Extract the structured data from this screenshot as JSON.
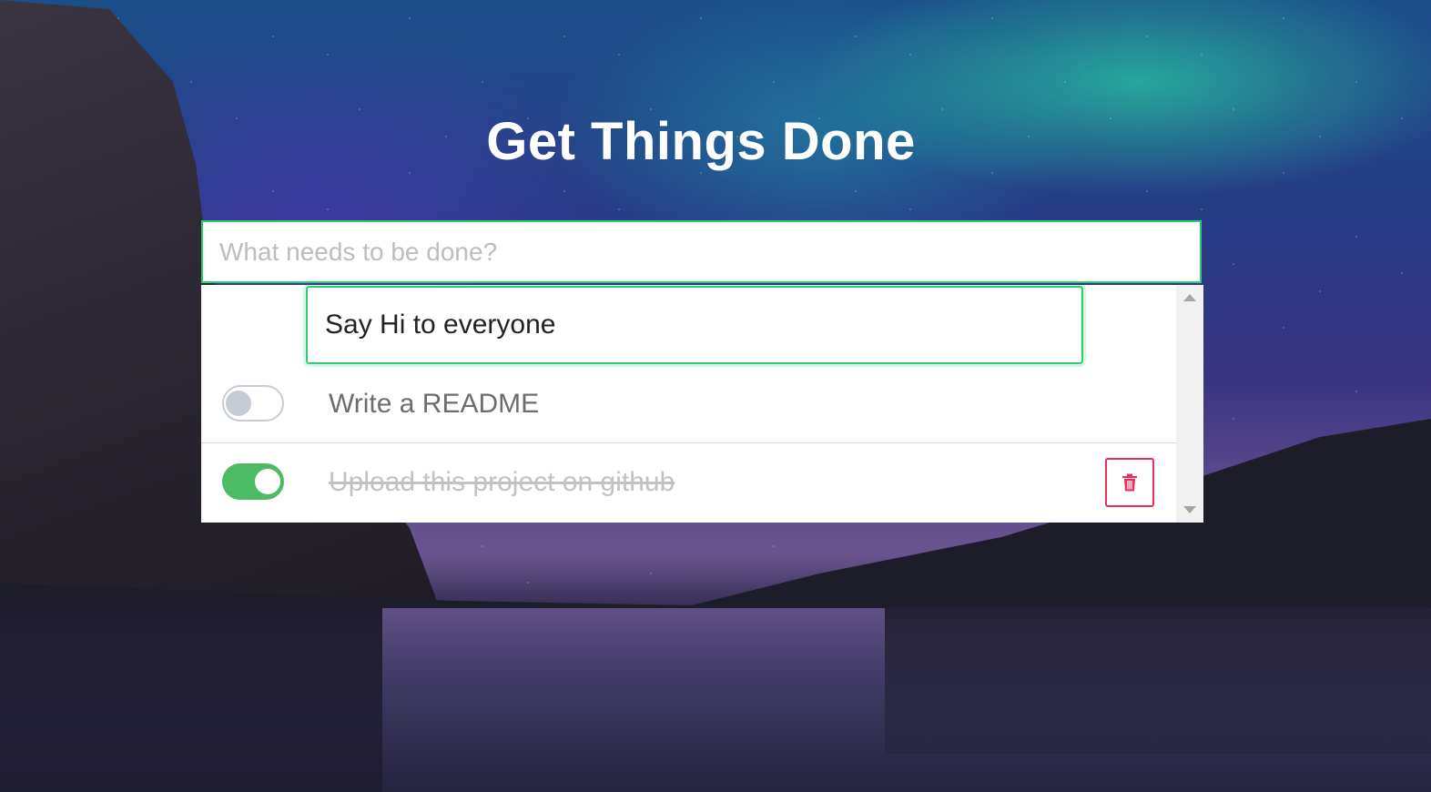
{
  "header": {
    "title": "Get Things Done"
  },
  "new_todo": {
    "placeholder": "What needs to be done?"
  },
  "editing": {
    "value": "Say Hi to everyone"
  },
  "todos": [
    {
      "label": "Write a README",
      "completed": false
    },
    {
      "label": "Upload this project on github",
      "completed": true
    }
  ],
  "icons": {
    "delete": "trash-icon",
    "scroll_up": "arrow-up-icon",
    "scroll_down": "arrow-down-icon"
  },
  "colors": {
    "accent": "#2ecc71",
    "toggle_on": "#4cbb63",
    "toggle_off": "#c5ccd3",
    "danger": "#e8305b"
  }
}
